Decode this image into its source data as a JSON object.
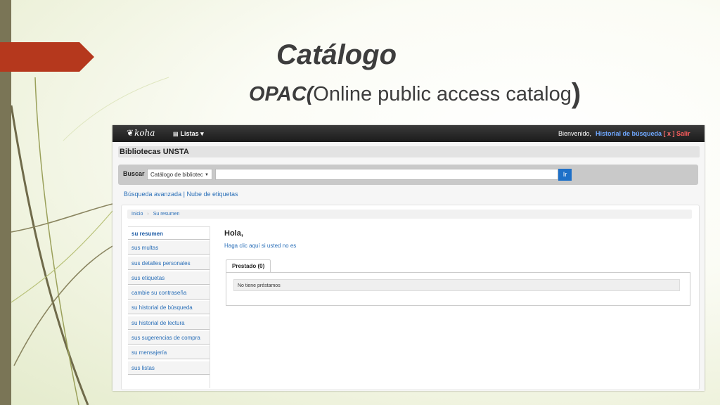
{
  "slide": {
    "title": "Catálogo",
    "subtitle_prefix": "OPAC(",
    "subtitle_main": "Online public access catalog",
    "subtitle_suffix": ")",
    "accent_colors": {
      "red_arrow": "#b5381d",
      "left_bar": "#7a7556"
    }
  },
  "navbar": {
    "logo": "koha",
    "lists": "Listas",
    "welcome": "Bienvenido,",
    "history": "Historial de búsqueda",
    "history_clear": "[ x ]",
    "logout": "Salir"
  },
  "library_name": "Bibliotecas UNSTA",
  "search": {
    "label": "Buscar",
    "scope_selected": "Catálogo de bibliotec",
    "query": "",
    "go_button": "Ir"
  },
  "sublinks": {
    "advanced": "Búsqueda avanzada",
    "separator": "|",
    "tag_cloud": "Nube de etiquetas"
  },
  "breadcrumb": {
    "home": "Inicio",
    "sep": "›",
    "current": "Su resumen"
  },
  "sidebar": {
    "items": [
      {
        "label": "su resumen"
      },
      {
        "label": "sus multas"
      },
      {
        "label": "sus detalles personales"
      },
      {
        "label": "sus etiquetas"
      },
      {
        "label": "cambie su contraseña"
      },
      {
        "label": "su historial de búsqueda"
      },
      {
        "label": "su historial de lectura"
      },
      {
        "label": "sus sugerencias de compra"
      },
      {
        "label": "su mensajería"
      },
      {
        "label": "sus listas"
      }
    ]
  },
  "main": {
    "greeting": "Hola,",
    "not_you": "Haga clic aquí si usted no es",
    "tab": "Prestado (0)",
    "no_loans": "No tiene préstamos"
  }
}
